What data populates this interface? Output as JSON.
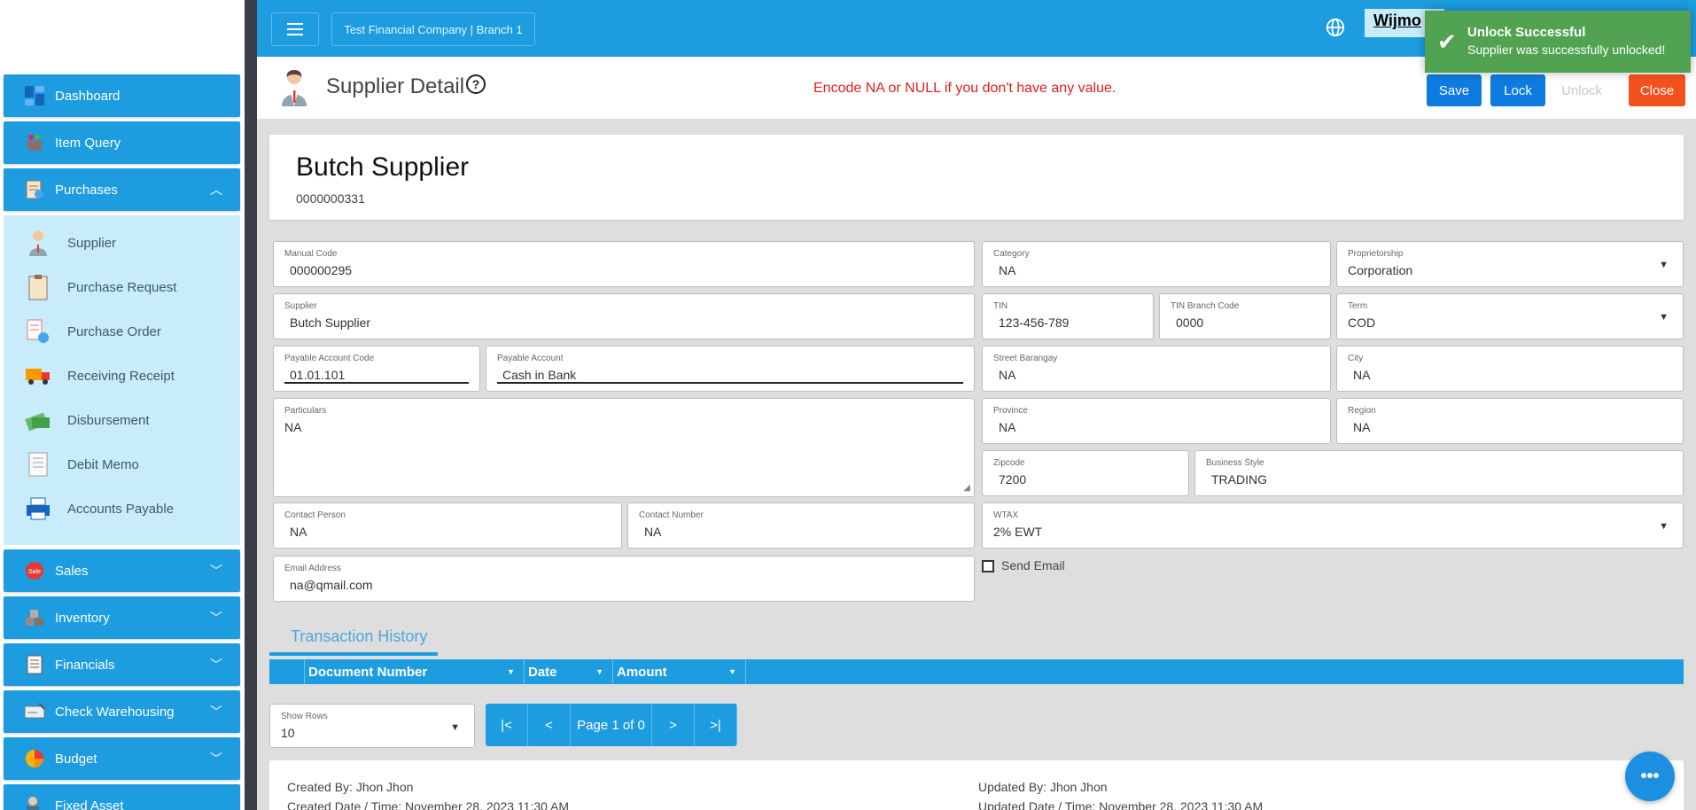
{
  "sidebar": {
    "items": [
      {
        "label": "Dashboard",
        "icon": "dashboard-icon"
      },
      {
        "label": "Item Query",
        "icon": "basket-icon"
      },
      {
        "label": "Purchases",
        "icon": "purchases-icon"
      },
      {
        "label": "Sales",
        "icon": "sales-icon"
      },
      {
        "label": "Inventory",
        "icon": "inventory-icon"
      },
      {
        "label": "Financials",
        "icon": "financials-icon"
      },
      {
        "label": "Check Warehousing",
        "icon": "check-icon"
      },
      {
        "label": "Budget",
        "icon": "budget-icon"
      },
      {
        "label": "Fixed Asset",
        "icon": "fixed-asset-icon"
      }
    ],
    "purchases_sub": [
      {
        "label": "Supplier",
        "icon": "supplier-icon"
      },
      {
        "label": "Purchase Request",
        "icon": "clipboard-icon"
      },
      {
        "label": "Purchase Order",
        "icon": "purchase-order-icon"
      },
      {
        "label": "Receiving Receipt",
        "icon": "truck-icon"
      },
      {
        "label": "Disbursement",
        "icon": "money-icon"
      },
      {
        "label": "Debit Memo",
        "icon": "memo-icon"
      },
      {
        "label": "Accounts Payable",
        "icon": "printer-icon"
      }
    ]
  },
  "topbar": {
    "company": "Test Financial Company | Branch 1",
    "user_label": "Wijmo"
  },
  "header": {
    "title": "Supplier Detail",
    "notice": "Encode NA or NULL if you don't have any value.",
    "save": "Save",
    "lock": "Lock",
    "unlock": "Unlock",
    "close": "Close"
  },
  "supplier": {
    "name": "Butch Supplier",
    "code": "0000000331"
  },
  "form": {
    "manual_code": {
      "label": "Manual Code",
      "value": "000000295"
    },
    "category": {
      "label": "Category",
      "value": "NA"
    },
    "proprietorship": {
      "label": "Proprietorship",
      "value": "Corporation"
    },
    "supplier": {
      "label": "Supplier",
      "value": "Butch Supplier"
    },
    "tin": {
      "label": "TIN",
      "value": "123-456-789"
    },
    "tin_branch": {
      "label": "TIN Branch Code",
      "value": "0000"
    },
    "term": {
      "label": "Term",
      "value": "COD"
    },
    "payable_code": {
      "label": "Payable Account Code",
      "value": "01.01.101"
    },
    "payable_account": {
      "label": "Payable Account",
      "value": "Cash in Bank"
    },
    "street": {
      "label": "Street Barangay",
      "value": "NA"
    },
    "city": {
      "label": "City",
      "value": "NA"
    },
    "particulars": {
      "label": "Particulars",
      "value": "NA"
    },
    "province": {
      "label": "Province",
      "value": "NA"
    },
    "region": {
      "label": "Region",
      "value": "NA"
    },
    "zipcode": {
      "label": "Zipcode",
      "value": "7200"
    },
    "business_style": {
      "label": "Business Style",
      "value": "TRADING"
    },
    "contact_person": {
      "label": "Contact Person",
      "value": "NA"
    },
    "contact_number": {
      "label": "Contact Number",
      "value": "NA"
    },
    "wtax": {
      "label": "WTAX",
      "value": "2% EWT"
    },
    "email": {
      "label": "Email Address",
      "value": "na@qmail.com"
    },
    "send_email": "Send Email"
  },
  "history": {
    "tab": "Transaction History",
    "columns": [
      "Document Number",
      "Date",
      "Amount"
    ],
    "show_rows_label": "Show Rows",
    "show_rows_value": "10",
    "page_text": "Page 1 of 0"
  },
  "footer": {
    "created_by": "Created By: Jhon Jhon",
    "created_date": "Created Date / Time: November 28, 2023 11:30 AM",
    "updated_by": "Updated By: Jhon Jhon",
    "updated_date": "Updated Date / Time: November 28, 2023 11:30 AM"
  },
  "toast": {
    "title": "Unlock Successful",
    "message": "Supplier was successfully unlocked!"
  },
  "colors": {
    "primary": "#1d9ce0",
    "close_button": "#f4511e",
    "button_blue": "#0d7be0",
    "toast_green": "#51a351",
    "notice_red": "#e02020"
  }
}
